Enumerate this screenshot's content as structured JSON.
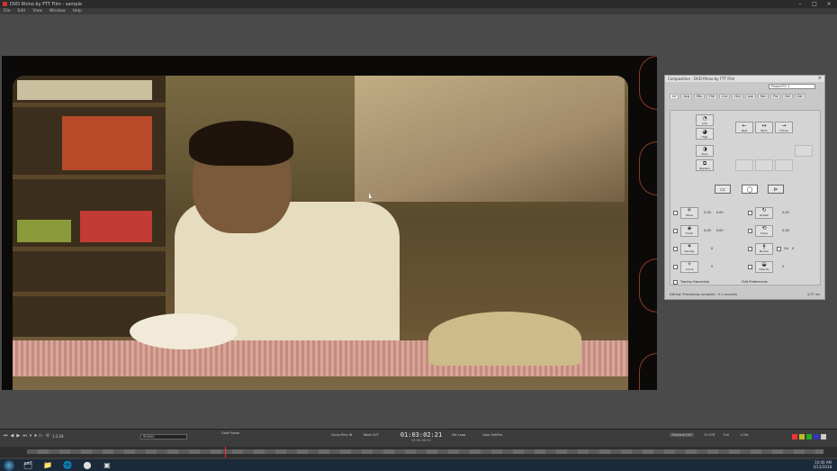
{
  "window": {
    "title": "DVD Rhino by FTT Film - sample"
  },
  "menu": [
    "File",
    "Edit",
    "View",
    "Window",
    "Help"
  ],
  "viewer": {
    "description_hidden": ""
  },
  "effect_panel": {
    "title": "Composition - DVD Rhino by FTT Film",
    "preset": "ProjectTO 1",
    "tabs": [
      "Inf",
      "Acq",
      "Mis",
      "Tim",
      "Cur",
      "Grd",
      "Loo",
      "Sec",
      "Flo",
      "Sel",
      "Cor"
    ],
    "toolbar_top": [
      {
        "label": "Low",
        "glyph": "◔"
      },
      {
        "label": "High",
        "glyph": "◕"
      },
      {
        "label": "Num",
        "glyph": "◑"
      },
      {
        "label": "Replace",
        "glyph": "⧉"
      }
    ],
    "direction_buttons": [
      {
        "label": "Past",
        "glyph": "←"
      },
      {
        "label": "Both",
        "glyph": "↔"
      },
      {
        "label": "Future",
        "glyph": "→"
      }
    ],
    "shapes": [
      "▭",
      "◯",
      "⊳"
    ],
    "params_left": [
      {
        "name": "Move",
        "glyph": "✛",
        "v1": "0.00",
        "v2": "0.00"
      },
      {
        "name": "Under",
        "glyph": "◈",
        "v1": "0.00",
        "v2": "0.00"
      },
      {
        "name": "Density",
        "glyph": "✶",
        "v1": "0",
        "v2": ""
      },
      {
        "name": "Curve",
        "glyph": "✧",
        "v1": "0",
        "v2": ""
      }
    ],
    "params_right": [
      {
        "name": "Rotate",
        "glyph": "↻",
        "v1": "0.00",
        "v2": ""
      },
      {
        "name": "Scale",
        "glyph": "⟲",
        "v1": "0.00",
        "v2": ""
      },
      {
        "name": "Border",
        "glyph": "ǂ",
        "v1": "On",
        "v2": "0"
      },
      {
        "name": "Opacity",
        "glyph": "◒",
        "v1": "0",
        "v2": ""
      }
    ],
    "option_label": "Tracing Ownership",
    "option2_label": "Edit Preferences",
    "status": "Editing: Processing complete : 0.1 seconds",
    "status_right": "4.37 ms"
  },
  "transport": {
    "left_controls": [
      "⏮",
      "◀",
      "▶",
      "⏭",
      "⏸",
      "⏹",
      "▷",
      "⟲"
    ],
    "zoom": "1:2.04",
    "clip_name": "REDNO",
    "marker": "Gold Frame",
    "prev_label": "Go-to-Prev IN",
    "next_label": "Next OUT",
    "timecode": "01:03:02:21",
    "timecode_sub": "01:00:00:00",
    "set_label": "Set Loop",
    "loop_label": "Loop Set/Pos",
    "timeline_label": "Timeline OUT",
    "fps": "23.976",
    "frames": "Full",
    "rate": "1.00x"
  },
  "colors": {
    "accent": "#e33",
    "swatches": [
      "#e33",
      "#bb2",
      "#2a2",
      "#33c",
      "#ccc"
    ]
  },
  "taskbar": {
    "items": [
      "🗂",
      "📁",
      "🌐",
      "⬤",
      "▣"
    ],
    "time": "10:00 AM",
    "date": "2/13/2018"
  }
}
